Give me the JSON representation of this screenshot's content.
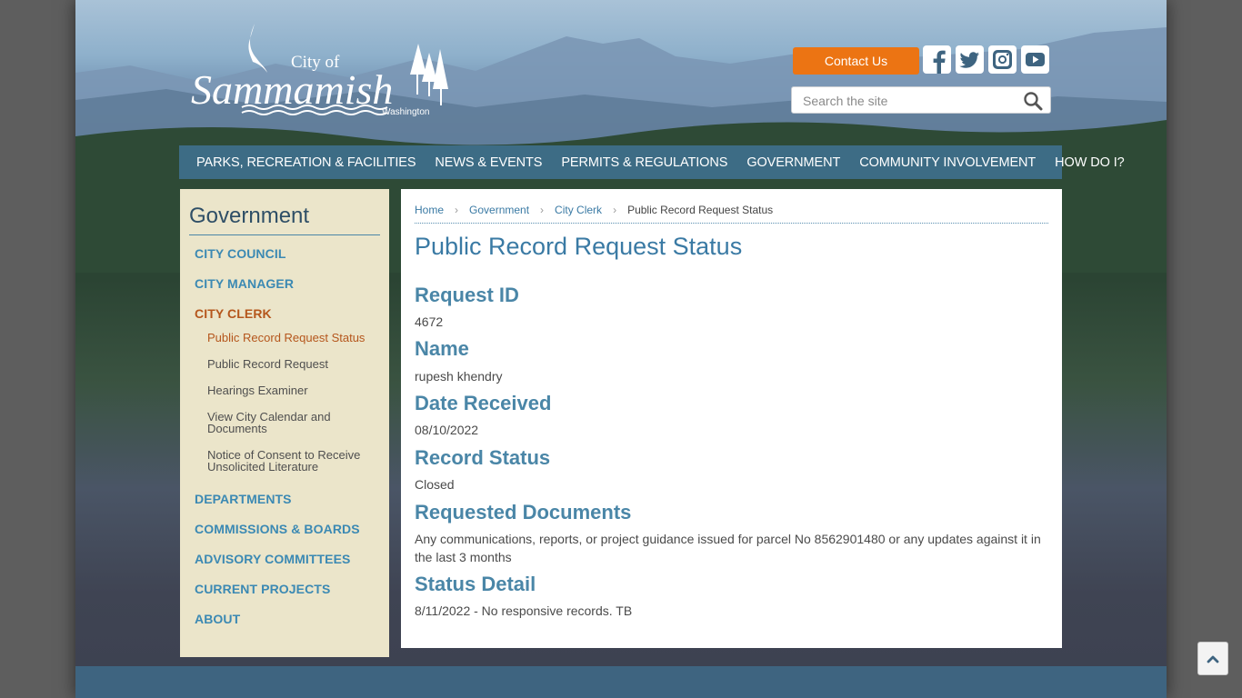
{
  "header": {
    "logo": {
      "line1": "City of",
      "line2": "Sammamish",
      "line3": "Washington"
    },
    "contact_label": "Contact Us",
    "social": [
      "facebook-icon",
      "twitter-icon",
      "instagram-icon",
      "youtube-icon"
    ],
    "search_placeholder": "Search the site"
  },
  "nav": [
    "PARKS, RECREATION & FACILITIES",
    "NEWS & EVENTS",
    "PERMITS & REGULATIONS",
    "GOVERNMENT",
    "COMMUNITY INVOLVEMENT",
    "HOW DO I?"
  ],
  "sidebar": {
    "title": "Government",
    "items": [
      "CITY COUNCIL",
      "CITY MANAGER",
      "CITY CLERK"
    ],
    "subitems": [
      "Public Record Request Status",
      "Public Record Request",
      "Hearings Examiner",
      "View City Calendar and Documents",
      "Notice of Consent to Receive Unsolicited Literature"
    ],
    "items_after": [
      "DEPARTMENTS",
      "COMMISSIONS & BOARDS",
      "ADVISORY COMMITTEES",
      "CURRENT PROJECTS",
      "ABOUT"
    ]
  },
  "breadcrumb": [
    "Home",
    "Government",
    "City Clerk",
    "Public Record Request Status"
  ],
  "main": {
    "title": "Public Record Request Status",
    "fields": [
      {
        "label": "Request ID",
        "value": "4672"
      },
      {
        "label": "Name",
        "value": "rupesh khendry"
      },
      {
        "label": "Date Received",
        "value": "08/10/2022"
      },
      {
        "label": "Record Status",
        "value": "Closed"
      },
      {
        "label": "Requested Documents",
        "value": "Any communications, reports, or project guidance issued for parcel No 8562901480 or any updates against it in the last 3 months"
      },
      {
        "label": "Status Detail",
        "value": "8/11/2022 - No responsive records. TB"
      }
    ]
  },
  "colors": {
    "accent_orange": "#ec7413",
    "nav_blue": "#3f6f8c",
    "link_blue": "#3a7aa4",
    "active_orange": "#b5561c",
    "sidebar_bg": "#ebe5ca"
  }
}
